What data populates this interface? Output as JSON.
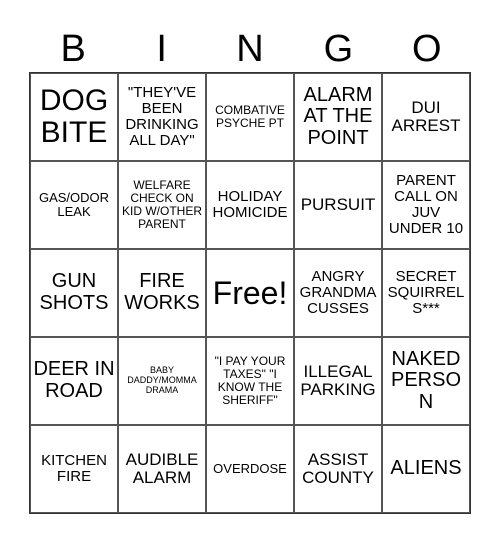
{
  "header": {
    "letters": [
      "B",
      "I",
      "N",
      "G",
      "O"
    ]
  },
  "board": {
    "rows": [
      [
        "DOG BITE",
        "\"THEY'VE BEEN DRINKING ALL DAY\"",
        "COMBATIVE PSYCHE PT",
        "ALARM AT THE POINT",
        "DUI ARREST"
      ],
      [
        "GAS/ODOR LEAK",
        "WELFARE CHECK ON KID W/OTHER PARENT",
        "HOLIDAY HOMICIDE",
        "PURSUIT",
        "PARENT CALL ON JUV UNDER 10"
      ],
      [
        "GUN SHOTS",
        "FIRE WORKS",
        "Free!",
        "ANGRY GRANDMA CUSSES",
        "SECRET SQUIRREL S***"
      ],
      [
        "DEER IN ROAD",
        "BABY DADDY/MOMMA DRAMA",
        "\"I PAY YOUR TAXES\" \"I KNOW THE SHERIFF\"",
        "ILLEGAL PARKING",
        "NAKED PERSON"
      ],
      [
        "KITCHEN FIRE",
        "AUDIBLE ALARM",
        "OVERDOSE",
        "ASSIST COUNTY",
        "ALIENS"
      ]
    ]
  }
}
